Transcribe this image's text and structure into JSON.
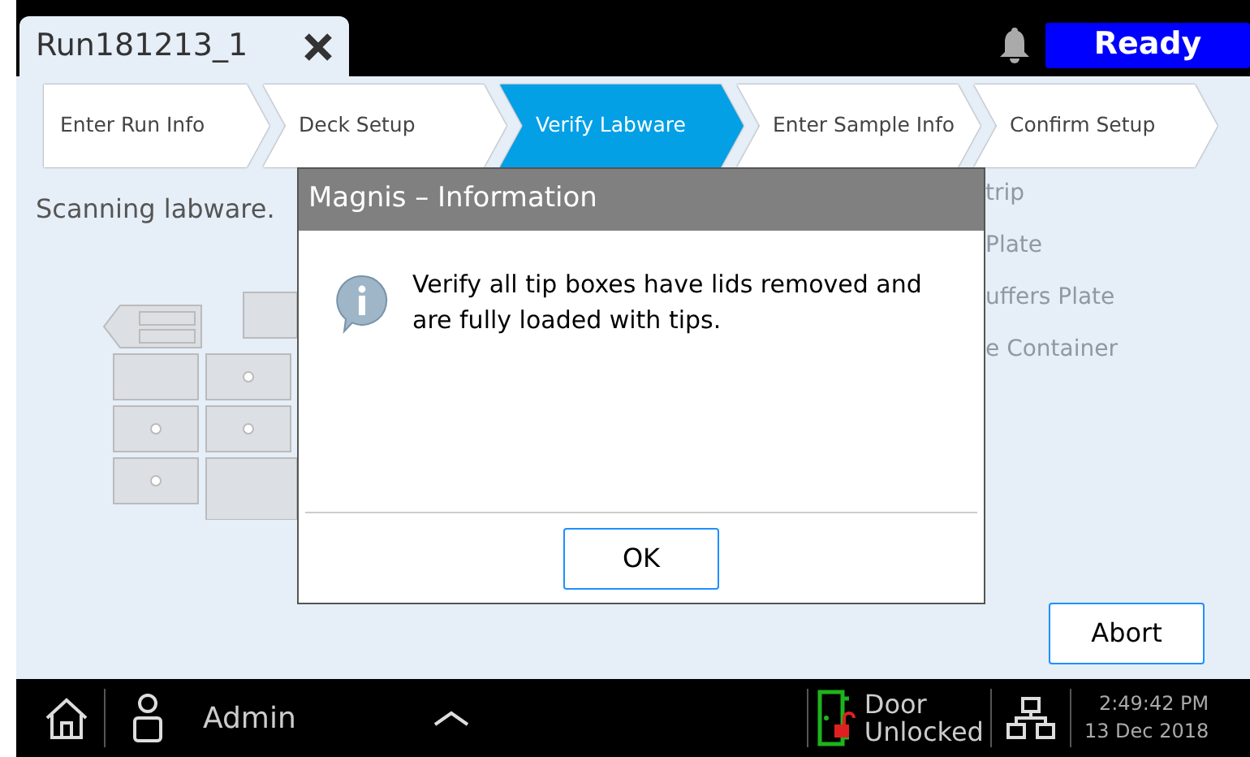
{
  "tab": {
    "title": "Run181213_1"
  },
  "status": {
    "label": "Ready"
  },
  "steps": [
    {
      "label": "Enter Run Info",
      "selected": false
    },
    {
      "label": "Deck Setup",
      "selected": false
    },
    {
      "label": "Verify Labware",
      "selected": true
    },
    {
      "label": "Enter Sample Info",
      "selected": false
    },
    {
      "label": "Confirm Setup",
      "selected": false
    }
  ],
  "status_text": "Scanning labware.",
  "labware_items": [
    "trip",
    "Plate",
    "uffers Plate",
    "e Container"
  ],
  "dialog": {
    "title": "Magnis – Information",
    "message": "Verify all tip boxes have lids removed and are fully loaded with tips.",
    "button": "OK"
  },
  "abort_button": "Abort",
  "bottom_bar": {
    "user": "Admin",
    "door_line_1": "Door",
    "door_line_2": "Unlocked",
    "time": "2:49:42 PM",
    "date": "13 Dec 2018"
  }
}
